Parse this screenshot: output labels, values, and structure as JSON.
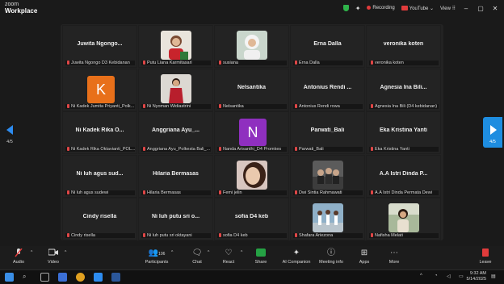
{
  "app": {
    "brand_line1": "zoom",
    "brand_line2": "Workplace"
  },
  "titlebar": {
    "recording": "Recording",
    "youtube": "YouTube",
    "view": "View"
  },
  "page": {
    "left": "4/5",
    "right": "4/5"
  },
  "tiles": [
    {
      "name": "Juwita  Ngongo...",
      "label": "Juwita Ngongo D3 Kebidanan"
    },
    {
      "photo": "woman-red-top",
      "label": "Putu Liana Karmitasari"
    },
    {
      "photo": "woman-white-hijab",
      "label": "susiana"
    },
    {
      "name": "Erna Dalla",
      "label": "Erna Dalla"
    },
    {
      "name": "veronika koten",
      "label": "veronika koten"
    },
    {
      "letter": "K",
      "color": "#e8701a",
      "label": "Ni Kadek Jumita Priyanti_Polk..."
    },
    {
      "photo": "woman-red-kebaya",
      "label": "Ni Nyoman Widiastrini"
    },
    {
      "name": "Nelsantika",
      "label": "Nelsantika"
    },
    {
      "name": "Antonius  Rendi ...",
      "label": "Antonius Rendi rowa"
    },
    {
      "name": "Agnesia Ina Bili...",
      "label": "Agnesia Ina Bili (D4 kebidanan)"
    },
    {
      "name": "Ni Kadek Rika O...",
      "label": "Ni Kadek Rika Oktavianti_POL..."
    },
    {
      "name": "Anggriana  Ayu_...",
      "label": "Anggriana Ayu_Polkesta Bali_..."
    },
    {
      "letter": "N",
      "color": "#8f2fbf",
      "label": "Nanda Arisanthi_D4 Promkes"
    },
    {
      "name": "Parwati_Bali",
      "label": "Parwati_Bali"
    },
    {
      "name": "Eka Kristina Yanti",
      "label": "Eka Kristina Yanti"
    },
    {
      "name": "Ni luh agus sud...",
      "label": "Ni luh agus sudewi"
    },
    {
      "name": "Hilaria Bermasas",
      "label": "Hilaria Bermasas"
    },
    {
      "photo": "woman-face-closeup",
      "label": "Femi jelin"
    },
    {
      "photo": "group-indoor",
      "label": "Dwi Sintia Rahmawati"
    },
    {
      "name": "A.A Istri Dinda P...",
      "label": "A.A Istri Dinda Permata Dewi"
    },
    {
      "name": "Cindy risella",
      "label": "Cindy risella"
    },
    {
      "name": "Ni luh putu sri o...",
      "label": "Ni luh putu sri oktayani"
    },
    {
      "name": "sofia D4 keb",
      "label": "sofia D4 keb"
    },
    {
      "photo": "group-dance",
      "label": "Shafara Ariezona"
    },
    {
      "photo": "woman-outdoor",
      "label": "Nafisha Melati"
    }
  ],
  "toolbar": {
    "audio": "Audio",
    "video": "Video",
    "participants": "Participants",
    "participants_count": "106",
    "chat": "Chat",
    "react": "React",
    "share": "Share",
    "ai": "AI Companion",
    "meeting_info": "Meeting info",
    "apps": "Apps",
    "more": "More",
    "leave": "Leave"
  },
  "taskbar": {
    "time": "9:32 AM",
    "date": "5/14/2025"
  }
}
